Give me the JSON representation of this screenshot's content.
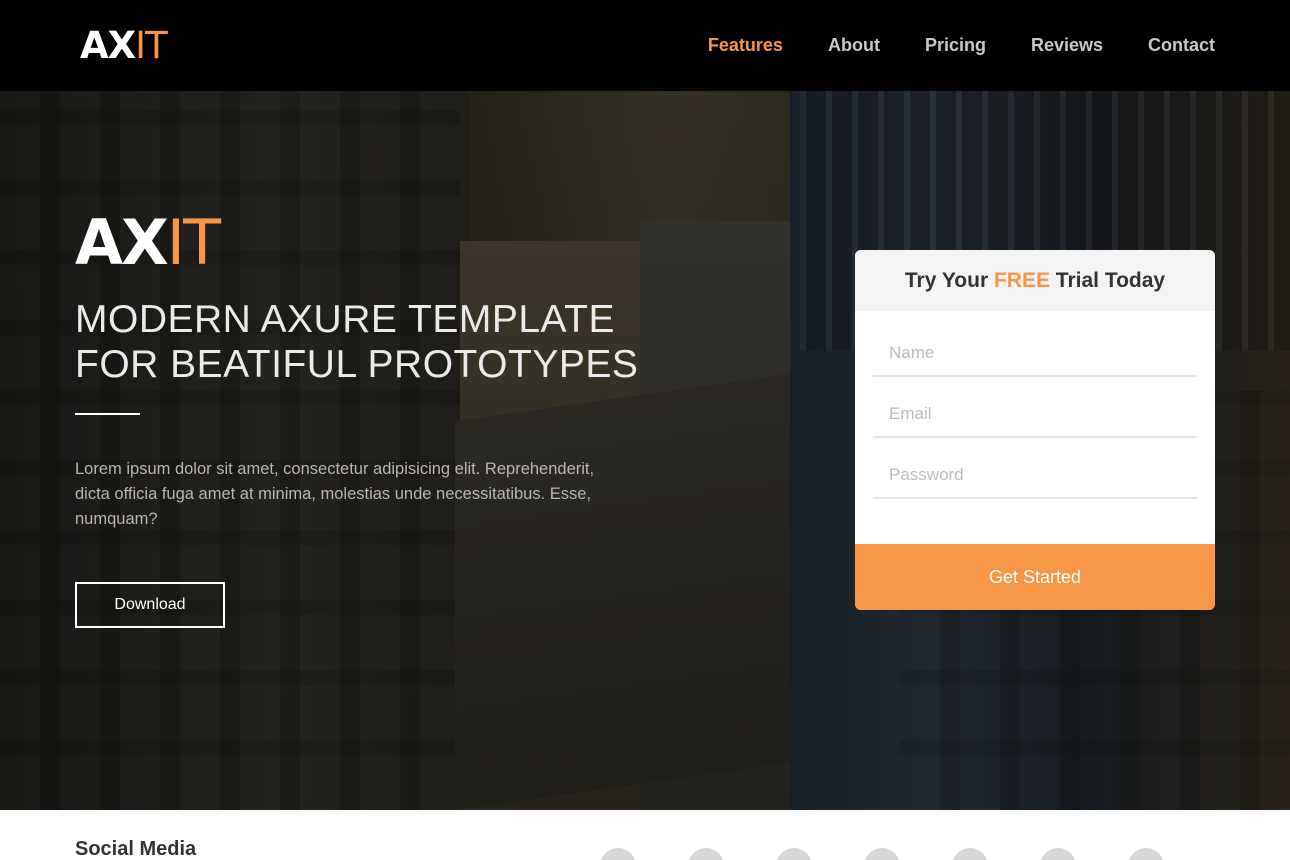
{
  "nav": {
    "logo": {
      "part1": "AX",
      "part2": "IT"
    },
    "items": [
      {
        "label": "Features",
        "active": true
      },
      {
        "label": "About",
        "active": false
      },
      {
        "label": "Pricing",
        "active": false
      },
      {
        "label": "Reviews",
        "active": false
      },
      {
        "label": "Contact",
        "active": false
      }
    ]
  },
  "hero": {
    "logo": {
      "part1": "AX",
      "part2": "IT"
    },
    "title_line1": "MODERN AXURE TEMPLATE",
    "title_line2": "FOR BEATIFUL PROTOTYPES",
    "text": "Lorem ipsum dolor sit amet, consectetur adipisicing elit. Reprehenderit, dicta officia fuga amet at minima, molestias unde necessitatibus. Esse, numquam?",
    "download_label": "Download"
  },
  "trial": {
    "title_prefix": "Try Your ",
    "title_highlight": "FREE",
    "title_suffix": " Trial Today",
    "name_placeholder": "Name",
    "email_placeholder": "Email",
    "password_placeholder": "Password",
    "submit_label": "Get Started"
  },
  "social": {
    "title": "Social Media",
    "icons": [
      "facebook-icon",
      "twitter-icon",
      "pinterest-icon",
      "dribbble-icon",
      "rss-icon",
      "skype-icon",
      "instagram-icon"
    ]
  },
  "colors": {
    "accent": "#f79646",
    "navbar": "#000000"
  }
}
